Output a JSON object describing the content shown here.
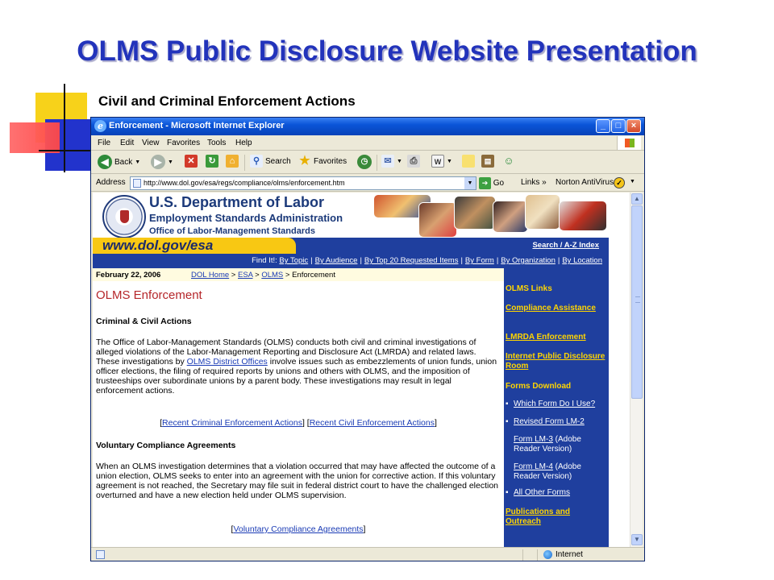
{
  "slide": {
    "title": "OLMS Public Disclosure Website Presentation",
    "subtitle": "Civil and Criminal Enforcement Actions"
  },
  "browser": {
    "window_title": "Enforcement - Microsoft Internet Explorer",
    "menu": [
      "File",
      "Edit",
      "View",
      "Favorites",
      "Tools",
      "Help"
    ],
    "toolbar": {
      "back": "Back",
      "search": "Search",
      "favorites": "Favorites"
    },
    "address_label": "Address",
    "address_url": "http://www.dol.gov/esa/regs/compliance/olms/enforcement.htm",
    "go_label": "Go",
    "links_label": "Links",
    "links_chevron": "»",
    "norton_label": "Norton AntiVirus",
    "status_zone": "Internet"
  },
  "dol_page": {
    "dept_name": "U.S. Department of Labor",
    "agency_name": "Employment Standards Administration",
    "office_name": "Office of Labor-Management Standards",
    "site_url": "www.dol.gov/esa",
    "search_link": "Search / A-Z Index",
    "findit_label": "Find It!:",
    "findit_links": [
      "By Topic",
      "By Audience",
      "By Top 20 Requested Items",
      "By Form",
      "By Organization",
      "By Location"
    ],
    "date": "February 22, 2006",
    "breadcrumbs": [
      "DOL Home",
      "ESA",
      "OLMS",
      "Enforcement"
    ],
    "heading": "OLMS Enforcement",
    "section1_title": "Criminal & Civil Actions",
    "section1_para_before": "The Office of Labor-Management Standards (OLMS) conducts both civil and criminal investigations of alleged violations of the Labor-Management Reporting and Disclosure Act (LMRDA) and related laws. These investigations by ",
    "section1_para_link": "OLMS District Offices",
    "section1_para_after": " involve issues such as embezzlements of union funds, union officer elections, the filing of required reports by unions and others with OLMS, and the imposition of trusteeships over subordinate unions by a parent body. These investigations may result in legal enforcement actions.",
    "recent_criminal": "Recent Criminal Enforcement Actions",
    "recent_civil": "Recent Civil Enforcement Actions",
    "section2_title": "Voluntary Compliance Agreements",
    "section2_para": "When an OLMS investigation determines that a violation occurred that may have affected the outcome of a union election, OLMS seeks to enter into an agreement with the union for corrective action. If this voluntary agreement is not reached, the Secretary may file suit in federal district court to have the challenged election overturned and have a new election held under OLMS supervision.",
    "vca_link": "Voluntary Compliance Agreements",
    "sidebar": {
      "olms_links": "OLMS Links",
      "compliance_assistance": "Compliance Assistance",
      "lmrda_enforcement": "LMRDA Enforcement",
      "internet_public_disclosure": "Internet Public Disclosure Room",
      "forms_download": "Forms Download",
      "which_form": "Which Form Do I Use?",
      "revised_lm2": "Revised Form LM-2",
      "form_lm3": "Form LM-3",
      "form_lm3_note": " (Adobe Reader Version)",
      "form_lm4": "Form LM-4",
      "form_lm4_note": " (Adobe Reader Version)",
      "all_other_forms": "All Other Forms",
      "publications": "Publications and Outreach"
    }
  },
  "colors": {
    "slide_title": "#2233bb",
    "dol_blue": "#1f3f9e",
    "dol_yellow": "#f8c813",
    "link_blue": "#1a3bb5",
    "heading_red": "#b5262a"
  }
}
